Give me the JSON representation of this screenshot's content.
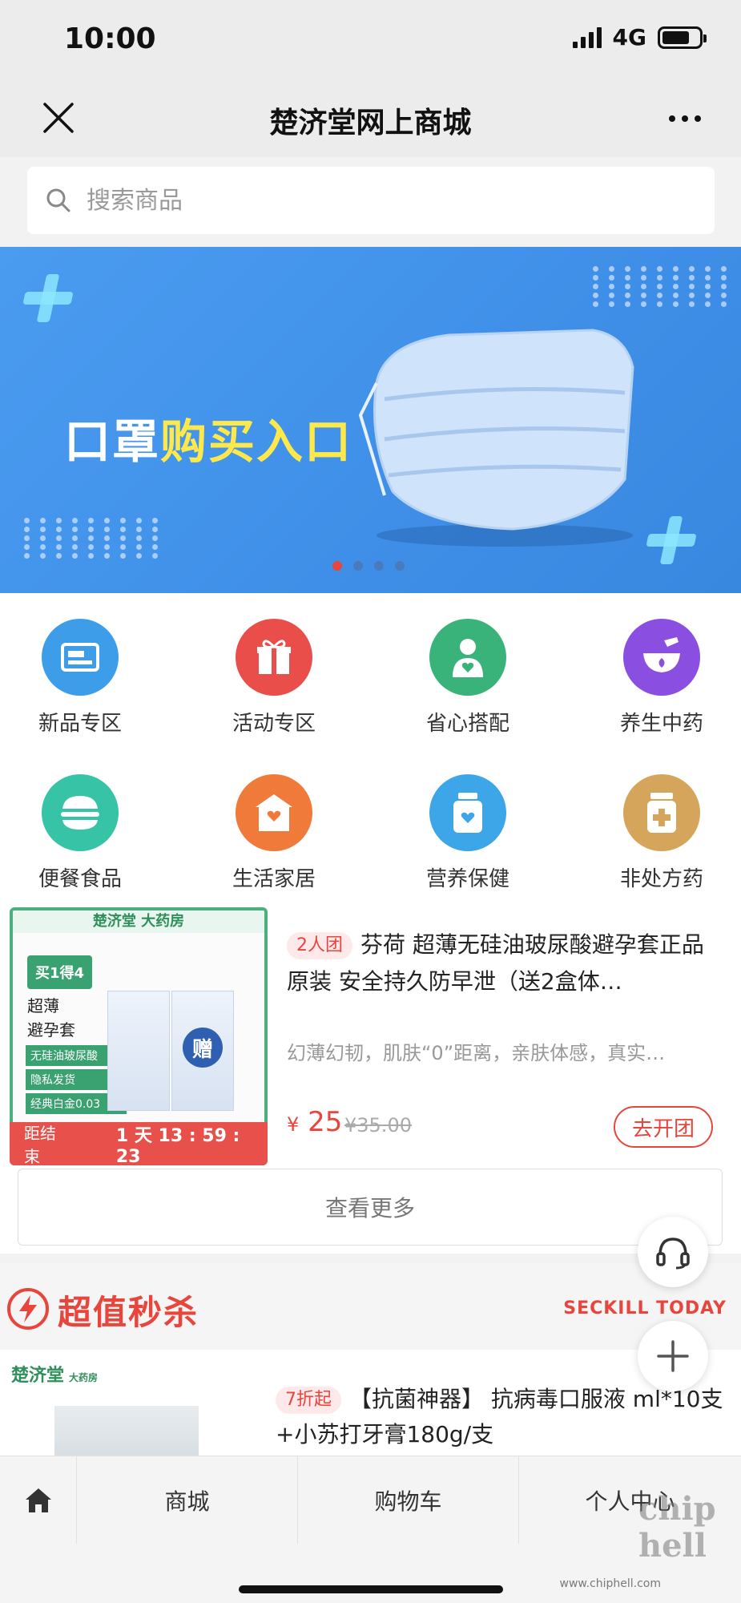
{
  "status": {
    "time": "10:00",
    "network": "4G",
    "battery_level": 0.75
  },
  "nav": {
    "title": "楚济堂网上商城"
  },
  "search": {
    "placeholder": "搜索商品"
  },
  "banner": {
    "text_white": "口罩",
    "text_yellow": "购买入口",
    "page_count": 4,
    "active_page": 1
  },
  "categories": [
    {
      "label": "新品专区",
      "icon": "new-arrivals-icon",
      "color": "#3d9de8"
    },
    {
      "label": "活动专区",
      "icon": "gift-icon",
      "color": "#ea4e4a"
    },
    {
      "label": "省心搭配",
      "icon": "consultant-icon",
      "color": "#3ab37a"
    },
    {
      "label": "养生中药",
      "icon": "mortar-icon",
      "color": "#8a4fe0"
    },
    {
      "label": "便餐食品",
      "icon": "burger-icon",
      "color": "#37c3a5"
    },
    {
      "label": "生活家居",
      "icon": "house-icon",
      "color": "#f07a3a"
    },
    {
      "label": "营养保健",
      "icon": "supplement-bottle-icon",
      "color": "#3da6e8"
    },
    {
      "label": "非处方药",
      "icon": "medicine-bottle-icon",
      "color": "#d4a55a"
    }
  ],
  "group_deal": {
    "image": {
      "brand": "楚济堂 大药房",
      "badge": "买1得4",
      "line1": "超薄",
      "line2": "避孕套",
      "tags": [
        "无硅油玻尿酸",
        "隐私发货",
        "经典白金0.03"
      ],
      "gift": "赠"
    },
    "countdown_label": "距结束",
    "countdown_days": "1",
    "countdown_day_unit": "天",
    "countdown_time": "13 : 59 : 23",
    "tag": "2人团",
    "title": "芬荷 超薄无硅油玻尿酸避孕套正品原装 安全持久防早泄（送2盒体…",
    "subtitle": "幻薄幻韧，肌肤“0”距离，亲肤体感，真实…",
    "price_symbol": "¥",
    "price": "25",
    "original_price": "¥35.00",
    "button": "去开团"
  },
  "more_button": "查看更多",
  "seckill": {
    "title": "超值秒杀",
    "subtitle": "SECKILL TODAY"
  },
  "seckill_item": {
    "brand": "楚济堂",
    "brand_sub": "大药房",
    "tag": "7折起",
    "title": "【抗菌神器】 抗病毒口服液 ml*10支+小苏打牙膏180g/支"
  },
  "tabbar": {
    "mall": "商城",
    "cart": "购物车",
    "user": "个人中心"
  },
  "watermark": {
    "logo": "chip hell",
    "url": "www.chiphell.com"
  }
}
